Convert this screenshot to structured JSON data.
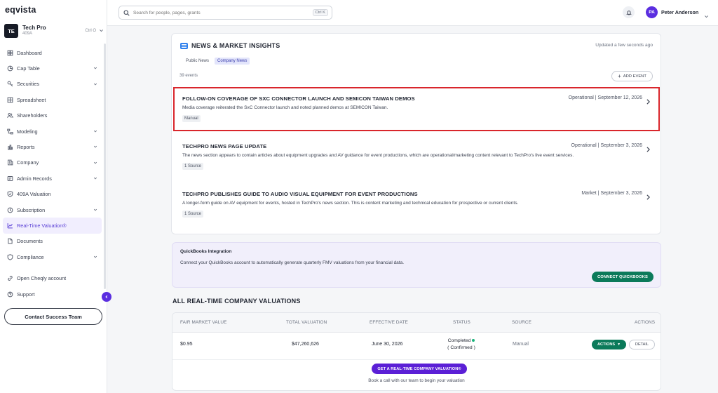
{
  "app": {
    "logo": "eqvista"
  },
  "company": {
    "initials": "TE",
    "name": "Tech Pro",
    "subtitle": "409A",
    "shortcut": "Ctrl O"
  },
  "sidebar": {
    "items": [
      {
        "label": "Dashboard",
        "icon": "dashboard-icon",
        "caret": false
      },
      {
        "label": "Cap Table",
        "icon": "pie-chart-icon",
        "caret": true
      },
      {
        "label": "Securities",
        "icon": "key-icon",
        "caret": true
      },
      {
        "label": "Spreadsheet",
        "icon": "grid-icon",
        "caret": false
      },
      {
        "label": "Shareholders",
        "icon": "users-icon",
        "caret": false
      },
      {
        "label": "Modeling",
        "icon": "flow-icon",
        "caret": true
      },
      {
        "label": "Reports",
        "icon": "bar-chart-icon",
        "caret": true
      },
      {
        "label": "Company",
        "icon": "building-icon",
        "caret": true
      },
      {
        "label": "Admin Records",
        "icon": "records-icon",
        "caret": true
      },
      {
        "label": "409A Valuation",
        "icon": "check-shield-icon",
        "caret": false
      },
      {
        "label": "Subscription",
        "icon": "subscription-icon",
        "caret": true
      },
      {
        "label": "Real-Time Valuation®",
        "icon": "trend-icon",
        "caret": false,
        "active": true
      },
      {
        "label": "Documents",
        "icon": "document-icon",
        "caret": false
      },
      {
        "label": "Compliance",
        "icon": "shield-icon",
        "caret": true
      }
    ],
    "footer_items": [
      {
        "label": "Open Cheqly account",
        "icon": "link-icon"
      },
      {
        "label": "Support",
        "icon": "help-icon"
      }
    ],
    "contact_label": "Contact Success Team"
  },
  "topbar": {
    "search_placeholder": "Search for people, pages, grants",
    "search_shortcut": "Ctrl K",
    "user_initials": "PA",
    "user_name": "Peter Anderson"
  },
  "news": {
    "title": "NEWS & MARKET INSIGHTS",
    "updated": "Updated a few seconds ago",
    "tabs": [
      {
        "label": "Public News",
        "active": false
      },
      {
        "label": "Company News",
        "active": true
      }
    ],
    "event_count": "39 events",
    "add_event_label": "ADD EVENT",
    "items": [
      {
        "title": "FOLLOW-ON COVERAGE OF SXC CONNECTOR LAUNCH AND SEMICON TAIWAN DEMOS",
        "meta": "Operational | September 12, 2026",
        "desc": "Media coverage reiterated the SxC Connector launch and noted planned demos at SEMICON Taiwan.",
        "tag": "Manual"
      },
      {
        "title": "TECHPRO NEWS PAGE UPDATE",
        "meta": "Operational | September 3, 2026",
        "desc": "The news section appears to contain articles about equipment upgrades and AV guidance for event productions, which are operational/marketing content relevant to TechPro's live event services.",
        "tag": "1 Source"
      },
      {
        "title": "TECHPRO PUBLISHES GUIDE TO AUDIO VISUAL EQUIPMENT FOR EVENT PRODUCTIONS",
        "meta": "Market | September 3, 2026",
        "desc": "A longer-form guide on AV equipment for events, hosted in TechPro's news section. This is content marketing and technical education for prospective or current clients.",
        "tag": "1 Source"
      }
    ]
  },
  "quickbooks": {
    "title": "QuickBooks Integration",
    "desc": "Connect your QuickBooks account to automatically generate quarterly FMV valuations from your financial data.",
    "button": "CONNECT QUICKBOOKS"
  },
  "valuations": {
    "title": "ALL REAL-TIME COMPANY VALUATIONS",
    "headers": [
      "FAIR MARKET VALUE",
      "TOTAL VALUATION",
      "EFFECTIVE DATE",
      "STATUS",
      "SOURCE",
      "ACTIONS"
    ],
    "row": {
      "fmv": "$0.95",
      "total": "$47,260,626",
      "date": "June 30, 2026",
      "status": "Completed",
      "status_sub": "( Confirmed )",
      "source": "Manual",
      "actions_label": "ACTIONS",
      "detail_label": "DETAIL"
    },
    "cta_button": "GET A REAL-TIME COMPANY VALUATION®",
    "cta_sub": "Book a call with our team to begin your valuation"
  },
  "colors": {
    "accent": "#5b2ee0",
    "green": "#0b7a5a",
    "highlight": "#d9262c"
  }
}
